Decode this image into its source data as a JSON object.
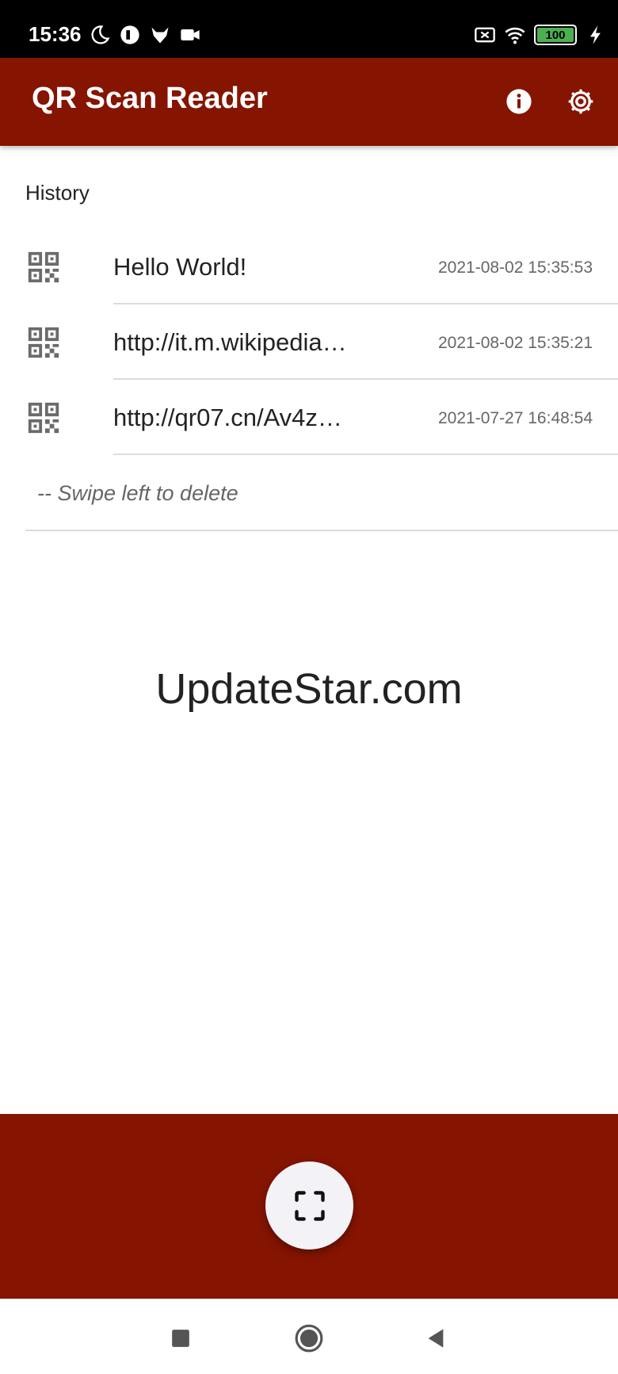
{
  "status_bar": {
    "time": "15:36",
    "battery": "100",
    "left_icons": [
      "moon-icon",
      "app-icon",
      "fox-icon",
      "camera-icon"
    ],
    "right_icons": [
      "no-sim-icon",
      "wifi-icon",
      "battery-icon",
      "charging-icon"
    ]
  },
  "app_bar": {
    "title": "QR Scan Reader",
    "actions": [
      "info-icon",
      "settings-icon"
    ],
    "color": "#851400"
  },
  "history": {
    "title": "History",
    "items": [
      {
        "text": "Hello World!",
        "time": "2021-08-02 15:35:53"
      },
      {
        "text": "http://it.m.wikipedia…",
        "time": "2021-08-02 15:35:21"
      },
      {
        "text": "http://qr07.cn/Av4z…",
        "time": "2021-07-27 16:48:54"
      }
    ],
    "hint": "-- Swipe left to delete"
  },
  "watermark": "UpdateStar.com",
  "fab": {
    "icon": "scan-frame-icon"
  },
  "nav_bar": {
    "buttons": [
      "recents-icon",
      "home-icon",
      "back-icon"
    ]
  }
}
